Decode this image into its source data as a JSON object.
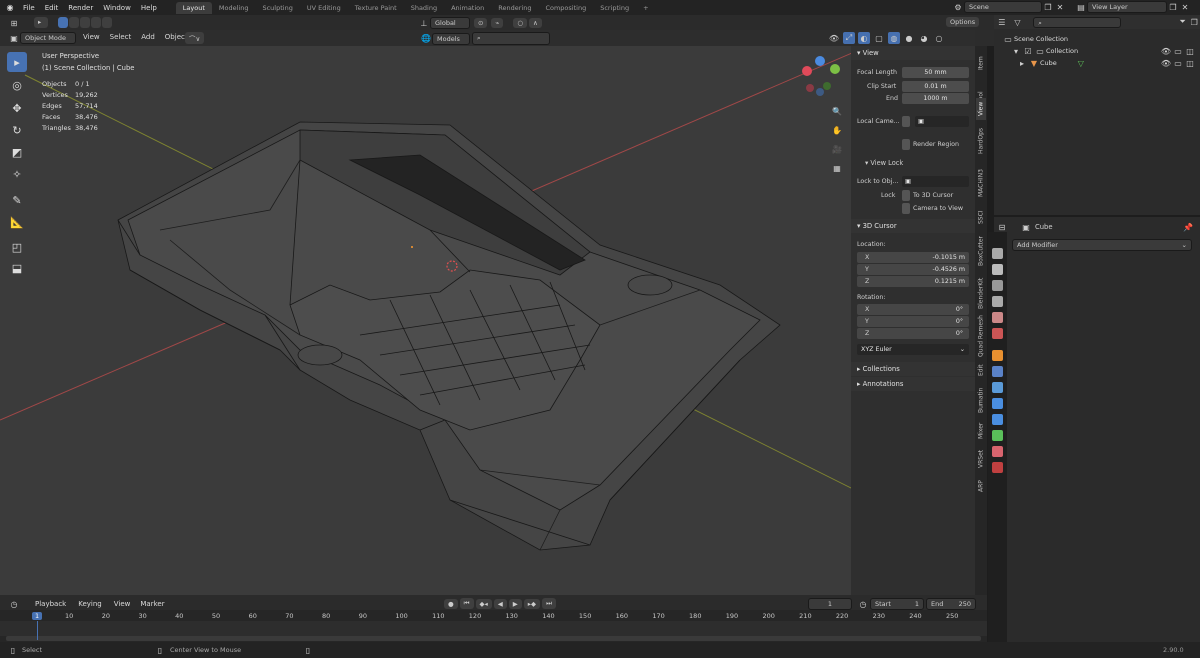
{
  "app": {
    "menu": [
      "File",
      "Edit",
      "Render",
      "Window",
      "Help"
    ],
    "workspaces": [
      "Layout",
      "Modeling",
      "Sculpting",
      "UV Editing",
      "Texture Paint",
      "Shading",
      "Animation",
      "Rendering",
      "Compositing",
      "Scripting"
    ],
    "add_workspace": "+",
    "scene": "Scene",
    "view_layer": "View Layer",
    "options": "Options"
  },
  "viewport": {
    "mode": "Object Mode",
    "menus": [
      "View",
      "Select",
      "Add",
      "Object"
    ],
    "orientation": "Global",
    "snap_models": "Models",
    "overlay_title": "User Perspective",
    "overlay_sub": "(1) Scene Collection | Cube",
    "stats": [
      {
        "label": "Objects",
        "value": "0 / 1"
      },
      {
        "label": "Vertices",
        "value": "19,262"
      },
      {
        "label": "Edges",
        "value": "57,714"
      },
      {
        "label": "Faces",
        "value": "38,476"
      },
      {
        "label": "Triangles",
        "value": "38,476"
      }
    ],
    "gizmo_axes": [
      "X",
      "Y",
      "Z"
    ]
  },
  "npanel": {
    "view_header": "View",
    "focal_length_label": "Focal Length",
    "focal_length": "50 mm",
    "clip_start_label": "Clip Start",
    "clip_start": "0.01 m",
    "end_label": "End",
    "end": "1000 m",
    "local_camera": "Local Came...",
    "render_region": "Render Region",
    "view_lock": "View Lock",
    "lock_to_obj": "Lock to Obj...",
    "lock": "Lock",
    "to_3d_cursor": "To 3D Cursor",
    "camera_to_view": "Camera to View",
    "cursor_header": "3D Cursor",
    "location": "Location:",
    "loc_x": "-0.1015 m",
    "loc_y": "-0.4526 m",
    "loc_z": "0.1215 m",
    "rotation": "Rotation:",
    "rot_x": "0°",
    "rot_y": "0°",
    "rot_z": "0°",
    "x": "X",
    "y": "Y",
    "z": "Z",
    "euler": "XYZ Euler",
    "collections": "Collections",
    "annotations": "Annotations"
  },
  "side_tabs": [
    "Item",
    "Tool",
    "View",
    "HardOps",
    "MACHIN3",
    "SSCI",
    "BoxCutter",
    "BlenderKit",
    "Quad Remesh",
    "Edit",
    "Bumatin",
    "Mixer",
    "VRSet",
    "ARP"
  ],
  "outliner": {
    "title": "Scene Collection",
    "collection": "Collection",
    "object": "Cube"
  },
  "properties": {
    "object": "Cube",
    "add_modifier": "Add Modifier"
  },
  "timeline": {
    "menus": [
      "Playback",
      "Keying",
      "View",
      "Marker"
    ],
    "current_frame": "1",
    "start_label": "Start",
    "start": "1",
    "end_label": "End",
    "end": "250",
    "ticks": [
      "1",
      "10",
      "20",
      "30",
      "40",
      "50",
      "60",
      "70",
      "80",
      "90",
      "100",
      "110",
      "120",
      "130",
      "140",
      "150",
      "160",
      "170",
      "180",
      "190",
      "200",
      "210",
      "220",
      "230",
      "240",
      "250"
    ]
  },
  "status": {
    "select": "Select",
    "center": "Center View to Mouse",
    "version": "2.90.0"
  }
}
